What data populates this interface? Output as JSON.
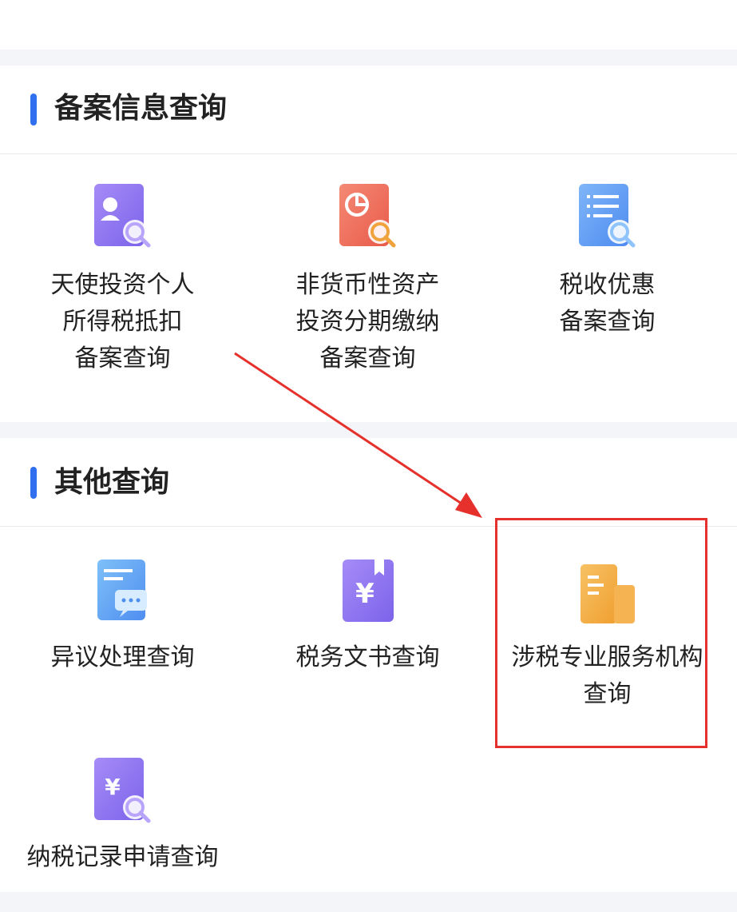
{
  "sections": [
    {
      "title": "备案信息查询",
      "items": [
        {
          "lines": [
            "天使投资个人",
            "所得税抵扣",
            "备案查询"
          ],
          "icon": "angel-investor-search-icon"
        },
        {
          "lines": [
            "非货币性资产",
            "投资分期缴纳",
            "备案查询"
          ],
          "icon": "pie-chart-search-icon"
        },
        {
          "lines": [
            "税收优惠",
            "备案查询"
          ],
          "icon": "list-search-icon"
        }
      ]
    },
    {
      "title": "其他查询",
      "items": [
        {
          "lines": [
            "异议处理查询"
          ],
          "icon": "document-chat-icon"
        },
        {
          "lines": [
            "税务文书查询"
          ],
          "icon": "yuan-bookmark-icon"
        },
        {
          "lines": [
            "涉税专业服务机构",
            "查询"
          ],
          "icon": "building-icon"
        },
        {
          "lines": [
            "纳税记录申请查询"
          ],
          "icon": "yuan-search-icon"
        }
      ]
    }
  ],
  "annotation": {
    "highlight_color": "#e5302b",
    "highlighted_item": "涉税专业服务机构查询"
  },
  "colors": {
    "section_bar": "#2f6ff0",
    "purple": "#8d74f0",
    "red": "#ee6a5a",
    "blue": "#5b9df3",
    "orange": "#f3a63b"
  }
}
